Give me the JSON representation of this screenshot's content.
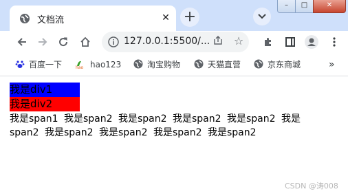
{
  "browser": {
    "tab_title": "文档流",
    "tab_close": "✕",
    "new_tab": "+",
    "url": "127.0.0.1:5500/...",
    "window_controls": {
      "minimize": "–",
      "maximize": "□",
      "close": "✕"
    }
  },
  "bookmarks": [
    {
      "label": "百度一下",
      "icon": "paw-icon"
    },
    {
      "label": "hao123",
      "icon": "hao123-icon"
    },
    {
      "label": "淘宝购物",
      "icon": "globe-icon"
    },
    {
      "label": "天猫直营",
      "icon": "globe-icon"
    },
    {
      "label": "京东商城",
      "icon": "globe-icon"
    }
  ],
  "bookmarks_more": "»",
  "page": {
    "div1": "我是div1",
    "div2": "我是div2",
    "spans": [
      "我是span1",
      "我是span2",
      "我是span2",
      "我是span2",
      "我是span2",
      "我是span2",
      "我是span2",
      "我是span2",
      "我是span2",
      "我是span2"
    ]
  },
  "watermark": "CSDN @涛008",
  "colors": {
    "div1_bg": "#0000ff",
    "div2_bg": "#ff0000",
    "tabstrip": "#cfe0fb"
  }
}
